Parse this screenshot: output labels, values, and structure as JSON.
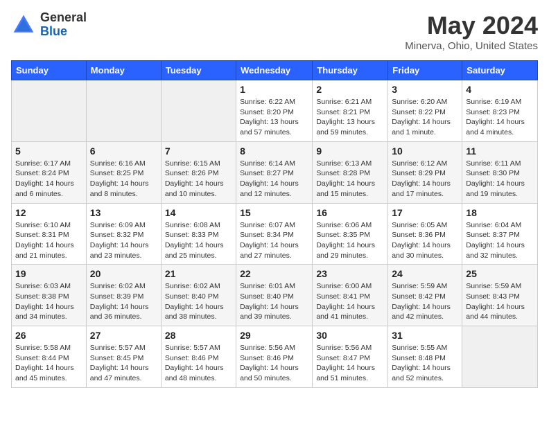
{
  "logo": {
    "general": "General",
    "blue": "Blue"
  },
  "title": {
    "month": "May 2024",
    "location": "Minerva, Ohio, United States"
  },
  "headers": [
    "Sunday",
    "Monday",
    "Tuesday",
    "Wednesday",
    "Thursday",
    "Friday",
    "Saturday"
  ],
  "weeks": [
    [
      {
        "day": "",
        "lines": []
      },
      {
        "day": "",
        "lines": []
      },
      {
        "day": "",
        "lines": []
      },
      {
        "day": "1",
        "lines": [
          "Sunrise: 6:22 AM",
          "Sunset: 8:20 PM",
          "Daylight: 13 hours",
          "and 57 minutes."
        ]
      },
      {
        "day": "2",
        "lines": [
          "Sunrise: 6:21 AM",
          "Sunset: 8:21 PM",
          "Daylight: 13 hours",
          "and 59 minutes."
        ]
      },
      {
        "day": "3",
        "lines": [
          "Sunrise: 6:20 AM",
          "Sunset: 8:22 PM",
          "Daylight: 14 hours",
          "and 1 minute."
        ]
      },
      {
        "day": "4",
        "lines": [
          "Sunrise: 6:19 AM",
          "Sunset: 8:23 PM",
          "Daylight: 14 hours",
          "and 4 minutes."
        ]
      }
    ],
    [
      {
        "day": "5",
        "lines": [
          "Sunrise: 6:17 AM",
          "Sunset: 8:24 PM",
          "Daylight: 14 hours",
          "and 6 minutes."
        ]
      },
      {
        "day": "6",
        "lines": [
          "Sunrise: 6:16 AM",
          "Sunset: 8:25 PM",
          "Daylight: 14 hours",
          "and 8 minutes."
        ]
      },
      {
        "day": "7",
        "lines": [
          "Sunrise: 6:15 AM",
          "Sunset: 8:26 PM",
          "Daylight: 14 hours",
          "and 10 minutes."
        ]
      },
      {
        "day": "8",
        "lines": [
          "Sunrise: 6:14 AM",
          "Sunset: 8:27 PM",
          "Daylight: 14 hours",
          "and 12 minutes."
        ]
      },
      {
        "day": "9",
        "lines": [
          "Sunrise: 6:13 AM",
          "Sunset: 8:28 PM",
          "Daylight: 14 hours",
          "and 15 minutes."
        ]
      },
      {
        "day": "10",
        "lines": [
          "Sunrise: 6:12 AM",
          "Sunset: 8:29 PM",
          "Daylight: 14 hours",
          "and 17 minutes."
        ]
      },
      {
        "day": "11",
        "lines": [
          "Sunrise: 6:11 AM",
          "Sunset: 8:30 PM",
          "Daylight: 14 hours",
          "and 19 minutes."
        ]
      }
    ],
    [
      {
        "day": "12",
        "lines": [
          "Sunrise: 6:10 AM",
          "Sunset: 8:31 PM",
          "Daylight: 14 hours",
          "and 21 minutes."
        ]
      },
      {
        "day": "13",
        "lines": [
          "Sunrise: 6:09 AM",
          "Sunset: 8:32 PM",
          "Daylight: 14 hours",
          "and 23 minutes."
        ]
      },
      {
        "day": "14",
        "lines": [
          "Sunrise: 6:08 AM",
          "Sunset: 8:33 PM",
          "Daylight: 14 hours",
          "and 25 minutes."
        ]
      },
      {
        "day": "15",
        "lines": [
          "Sunrise: 6:07 AM",
          "Sunset: 8:34 PM",
          "Daylight: 14 hours",
          "and 27 minutes."
        ]
      },
      {
        "day": "16",
        "lines": [
          "Sunrise: 6:06 AM",
          "Sunset: 8:35 PM",
          "Daylight: 14 hours",
          "and 29 minutes."
        ]
      },
      {
        "day": "17",
        "lines": [
          "Sunrise: 6:05 AM",
          "Sunset: 8:36 PM",
          "Daylight: 14 hours",
          "and 30 minutes."
        ]
      },
      {
        "day": "18",
        "lines": [
          "Sunrise: 6:04 AM",
          "Sunset: 8:37 PM",
          "Daylight: 14 hours",
          "and 32 minutes."
        ]
      }
    ],
    [
      {
        "day": "19",
        "lines": [
          "Sunrise: 6:03 AM",
          "Sunset: 8:38 PM",
          "Daylight: 14 hours",
          "and 34 minutes."
        ]
      },
      {
        "day": "20",
        "lines": [
          "Sunrise: 6:02 AM",
          "Sunset: 8:39 PM",
          "Daylight: 14 hours",
          "and 36 minutes."
        ]
      },
      {
        "day": "21",
        "lines": [
          "Sunrise: 6:02 AM",
          "Sunset: 8:40 PM",
          "Daylight: 14 hours",
          "and 38 minutes."
        ]
      },
      {
        "day": "22",
        "lines": [
          "Sunrise: 6:01 AM",
          "Sunset: 8:40 PM",
          "Daylight: 14 hours",
          "and 39 minutes."
        ]
      },
      {
        "day": "23",
        "lines": [
          "Sunrise: 6:00 AM",
          "Sunset: 8:41 PM",
          "Daylight: 14 hours",
          "and 41 minutes."
        ]
      },
      {
        "day": "24",
        "lines": [
          "Sunrise: 5:59 AM",
          "Sunset: 8:42 PM",
          "Daylight: 14 hours",
          "and 42 minutes."
        ]
      },
      {
        "day": "25",
        "lines": [
          "Sunrise: 5:59 AM",
          "Sunset: 8:43 PM",
          "Daylight: 14 hours",
          "and 44 minutes."
        ]
      }
    ],
    [
      {
        "day": "26",
        "lines": [
          "Sunrise: 5:58 AM",
          "Sunset: 8:44 PM",
          "Daylight: 14 hours",
          "and 45 minutes."
        ]
      },
      {
        "day": "27",
        "lines": [
          "Sunrise: 5:57 AM",
          "Sunset: 8:45 PM",
          "Daylight: 14 hours",
          "and 47 minutes."
        ]
      },
      {
        "day": "28",
        "lines": [
          "Sunrise: 5:57 AM",
          "Sunset: 8:46 PM",
          "Daylight: 14 hours",
          "and 48 minutes."
        ]
      },
      {
        "day": "29",
        "lines": [
          "Sunrise: 5:56 AM",
          "Sunset: 8:46 PM",
          "Daylight: 14 hours",
          "and 50 minutes."
        ]
      },
      {
        "day": "30",
        "lines": [
          "Sunrise: 5:56 AM",
          "Sunset: 8:47 PM",
          "Daylight: 14 hours",
          "and 51 minutes."
        ]
      },
      {
        "day": "31",
        "lines": [
          "Sunrise: 5:55 AM",
          "Sunset: 8:48 PM",
          "Daylight: 14 hours",
          "and 52 minutes."
        ]
      },
      {
        "day": "",
        "lines": []
      }
    ]
  ]
}
